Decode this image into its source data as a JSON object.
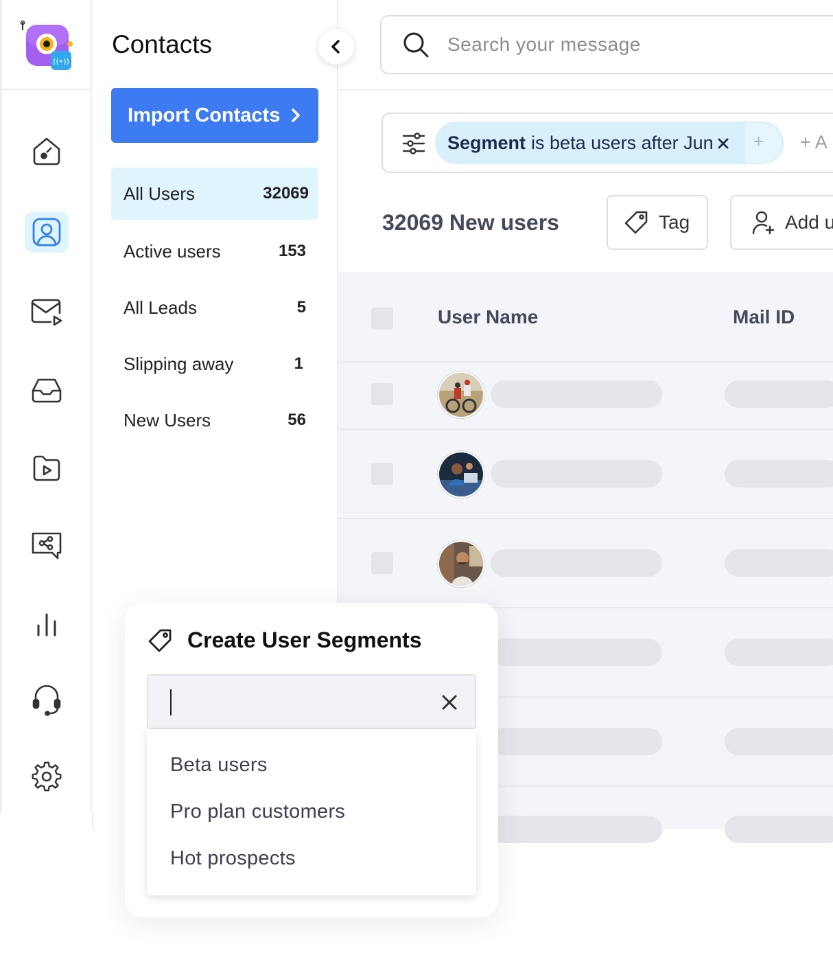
{
  "sidebar": {
    "icons": [
      "home-icon",
      "contacts-icon",
      "mail-icon",
      "inbox-icon",
      "video-folder-icon",
      "share-chat-icon",
      "analytics-icon",
      "support-headset-icon",
      "settings-icon"
    ],
    "active": "contacts-icon"
  },
  "contacts": {
    "title": "Contacts",
    "import_label": "Import Contacts",
    "segments": [
      {
        "label": "All Users",
        "count": "32069"
      },
      {
        "label": "Active users",
        "count": "153"
      },
      {
        "label": "All Leads",
        "count": "5"
      },
      {
        "label": "Slipping away",
        "count": "1"
      },
      {
        "label": "New Users",
        "count": "56"
      }
    ]
  },
  "search": {
    "placeholder": "Search your message"
  },
  "filter": {
    "field": "Segment",
    "text": "is beta users after Jun",
    "add_label": "+ A"
  },
  "toolbar": {
    "users_count": "32069 New users",
    "tag_label": "Tag",
    "add_label": "Add u"
  },
  "table": {
    "columns": [
      "User Name",
      "Mail ID"
    ],
    "rows": 5
  },
  "popover": {
    "title": "Create User Segments",
    "input_value": "",
    "options": [
      "Beta users",
      "Pro plan customers",
      "Hot prospects"
    ]
  },
  "colors": {
    "accent": "#3d7bf3",
    "active_bg": "#dff4fc",
    "logo_purple": "#9b5cf6"
  }
}
